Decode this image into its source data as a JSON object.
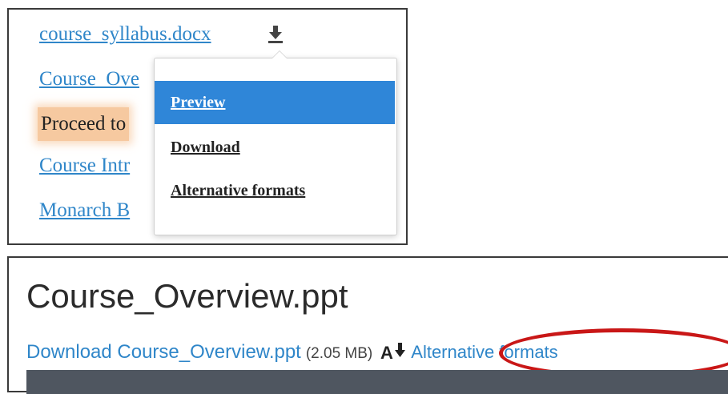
{
  "top": {
    "file_link": "course_syllabus.docx",
    "links": {
      "overview": "Course_Ove",
      "proceed": "Proceed to",
      "intro": "Course Intr",
      "monarch": "Monarch B"
    },
    "menu": {
      "preview": "Preview",
      "download": "Download",
      "alternative": "Alternative formats"
    }
  },
  "bottom": {
    "title": "Course_Overview.ppt",
    "download_link": "Download Course_Overview.ppt",
    "size": "(2.05 MB)",
    "alt_formats": "Alternative formats"
  },
  "icons": [
    "download-icon",
    "alternative-formats-icon"
  ],
  "colors": {
    "link": "#2f86c9",
    "menu_highlight": "#2f86d8",
    "highlight": "#f6c9a0",
    "annotation": "#c91717"
  }
}
